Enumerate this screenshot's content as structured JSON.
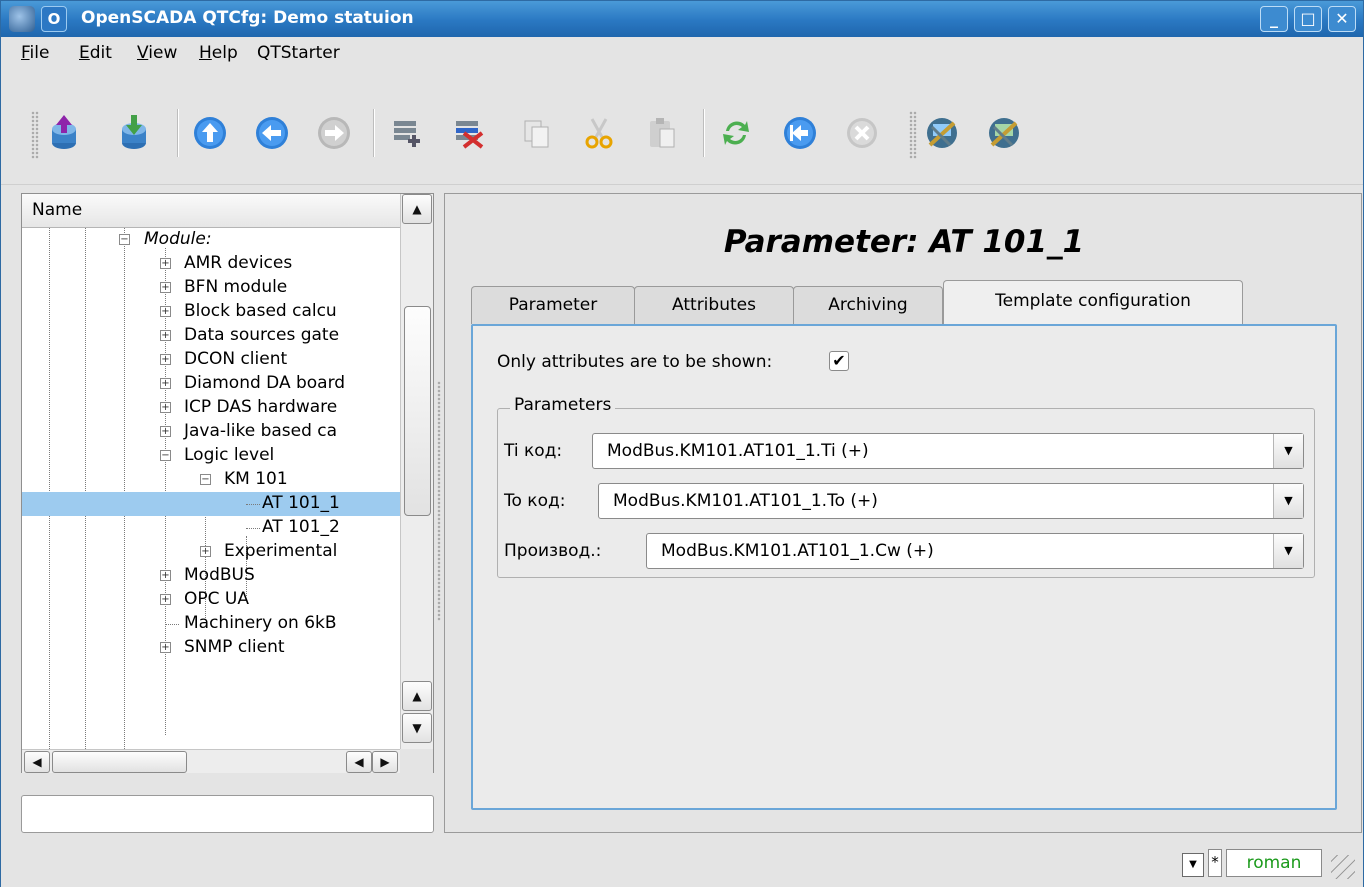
{
  "window": {
    "title": "OpenSCADA QTCfg: Demo statuion",
    "sys_menu_glyph": "O"
  },
  "menubar": [
    {
      "label": "File",
      "mnemonic": "F"
    },
    {
      "label": "Edit",
      "mnemonic": "E"
    },
    {
      "label": "View",
      "mnemonic": "V"
    },
    {
      "label": "Help",
      "mnemonic": "H"
    },
    {
      "label": "QTStarter"
    }
  ],
  "toolbar": {
    "tools": [
      "db-load-icon",
      "db-save-icon",
      "go-up-icon",
      "go-back-icon",
      "go-forward-icon",
      "item-add-icon",
      "item-delete-icon",
      "copy-icon",
      "cut-icon",
      "paste-icon",
      "refresh-icon",
      "start-icon",
      "stop-icon",
      "qtcfg-icon",
      "vision-icon"
    ]
  },
  "tree": {
    "header": "Name",
    "rows": [
      {
        "label": "Module:",
        "italic": true
      },
      {
        "label": "AMR devices"
      },
      {
        "label": "BFN module"
      },
      {
        "label": "Block based calcu"
      },
      {
        "label": "Data sources gate"
      },
      {
        "label": "DCON client"
      },
      {
        "label": "Diamond DA board"
      },
      {
        "label": "ICP DAS hardware"
      },
      {
        "label": "Java-like based ca"
      },
      {
        "label": "Logic level"
      },
      {
        "label": "KM 101"
      },
      {
        "label": "AT 101_1",
        "selected": true
      },
      {
        "label": "AT 101_2"
      },
      {
        "label": "Experimental"
      },
      {
        "label": "ModBUS"
      },
      {
        "label": "OPC UA"
      },
      {
        "label": "Machinery on 6kB"
      },
      {
        "label": "SNMP client"
      }
    ]
  },
  "status_field": {
    "value": ""
  },
  "page": {
    "title": "Parameter: AT 101_1",
    "tabs": [
      {
        "label": "Parameter"
      },
      {
        "label": "Attributes"
      },
      {
        "label": "Archiving"
      },
      {
        "label": "Template configuration",
        "active": true
      }
    ],
    "only_attrs": {
      "label": "Only attributes are to be shown:",
      "checked": true,
      "glyph": "✔"
    },
    "parameters": {
      "legend": "Parameters",
      "items": [
        {
          "label": "Ti код:",
          "value": "ModBus.KM101.AT101_1.Ti (+)"
        },
        {
          "label": "To код:",
          "value": "ModBus.KM101.AT101_1.To (+)"
        },
        {
          "label": "Производ.:",
          "value": "ModBus.KM101.AT101_1.Cw (+)"
        }
      ]
    }
  },
  "statusbar": {
    "star": "*",
    "user": "roman"
  },
  "colors": {
    "title_bar": "#2a78c2",
    "selection": "#9dcbef",
    "user": "#1b9a1b",
    "focus_border": "#6aa6d8"
  }
}
